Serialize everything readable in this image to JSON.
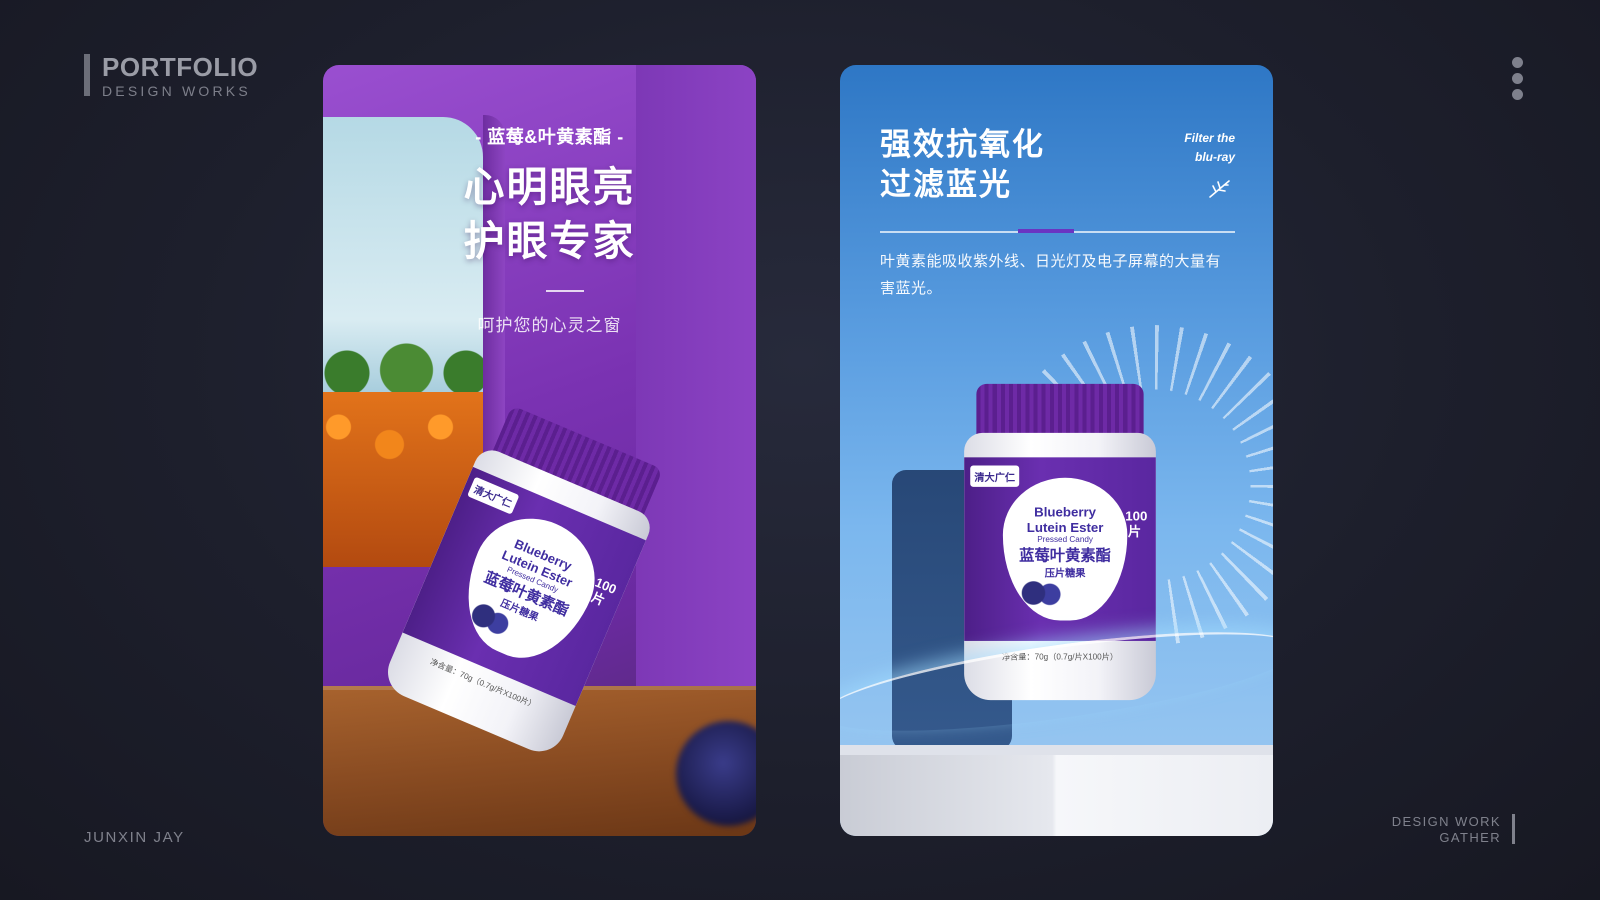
{
  "brand": {
    "title": "PORTFOLIO",
    "subtitle": "DESIGN WORKS"
  },
  "footer": {
    "author": "JUNXIN JAY",
    "gather_line1": "DESIGN WORK",
    "gather_line2": "GATHER"
  },
  "left_card": {
    "tag": "- 蓝莓&叶黄素酯 -",
    "headline_line1": "心明眼亮",
    "headline_line2": "护眼专家",
    "divider": "——",
    "slogan": "呵护您的心灵之窗"
  },
  "right_card": {
    "headline_line1": "强效抗氧化",
    "headline_line2": "过滤蓝光",
    "en_line1": "Filter the",
    "en_line2": "blu-ray",
    "body": "叶黄素能吸收紫外线、日光灯及电子屏幕的大量有害蓝光。"
  },
  "product": {
    "brand": "清大广仁",
    "name_en_line1": "Blueberry",
    "name_en_line2": "Lutein Ester",
    "name_en_line3": "Pressed Candy",
    "name_cn_line1": "蓝莓叶黄素酯",
    "name_cn_line2": "压片糖果",
    "count": "100片",
    "net_weight": "净含量：70g（0.7g/片X100片）"
  },
  "colors": {
    "background": "#1d1f2c",
    "left_card": "#7a32b2",
    "right_card": "#5a9de0",
    "accent": "#6a34c2"
  }
}
